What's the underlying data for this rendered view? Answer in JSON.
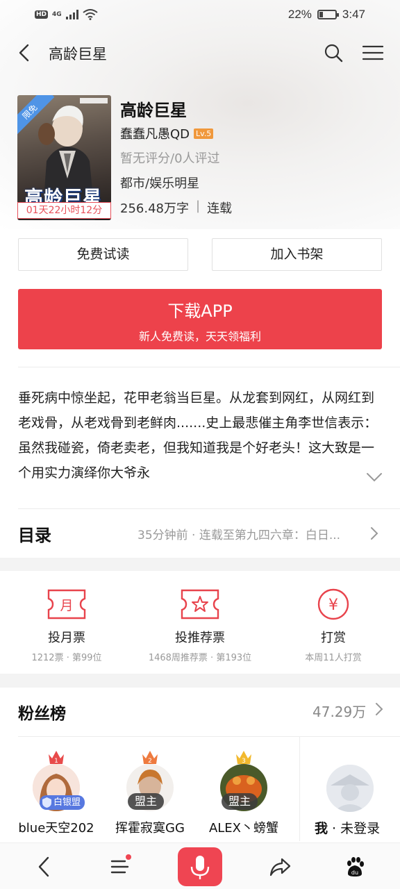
{
  "status_bar": {
    "hd": "HD",
    "network": "4G",
    "battery_text": "22%",
    "battery_level": 0.22,
    "time": "3:47"
  },
  "nav": {
    "title": "高龄巨星",
    "icons": [
      "back-icon",
      "search-icon",
      "menu-icon"
    ]
  },
  "book": {
    "cover_ribbon": "限免",
    "cover_title": "高龄巨星",
    "free_timer": "01天22小时12分",
    "title": "高龄巨星",
    "author": "蠢蠢凡愚QD",
    "author_level": "Lv.5",
    "rating": "暂无评分/0人评过",
    "genre": "都市/娱乐明星",
    "word_count": "256.48万字",
    "status": "连载"
  },
  "actions": {
    "try_read": "免费试读",
    "add_shelf": "加入书架"
  },
  "download": {
    "title": "下载APP",
    "subtitle": "新人免费读，天天领福利"
  },
  "intro": {
    "text": "垂死病中惊坐起，花甲老翁当巨星。从龙套到网红，从网红到老戏骨，从老戏骨到老鲜肉.......史上最悲催主角李世信表示：虽然我碰瓷，倚老卖老，但我知道我是个好老头！这大致是一个用实力演绎你大爷永"
  },
  "toc": {
    "label": "目录",
    "info": "35分钟前 · 连载至第九四六章：白日..."
  },
  "tickets": [
    {
      "name": "投月票",
      "sub": "1212票 · 第99位",
      "icon": "monthly-ticket-icon",
      "glyph": "月"
    },
    {
      "name": "投推荐票",
      "sub": "1468周推荐票 · 第193位",
      "icon": "recommend-ticket-icon"
    },
    {
      "name": "打赏",
      "sub": "本周11人打赏",
      "icon": "tip-yen-icon",
      "glyph": "¥"
    }
  ],
  "fans": {
    "title": "粉丝榜",
    "total": "47.29万",
    "list": [
      {
        "rank": "1",
        "badge": "白银盟",
        "name": "blue天空202"
      },
      {
        "rank": "2",
        "badge": "盟主",
        "name": "挥霍寂寞GG"
      },
      {
        "rank": "3",
        "badge": "盟主",
        "name": "ALEX丶螃蟹"
      }
    ],
    "me_prefix": "我",
    "me_status": " · 未登录"
  },
  "bottom_bar": {
    "icons": [
      "back-icon",
      "menu-icon",
      "microphone-icon",
      "share-icon",
      "baidu-logo-icon"
    ]
  },
  "colors": {
    "accent_red": "#ed424b",
    "ribbon_blue": "#4f94e6",
    "level_orange": "#f0983c",
    "silver_badge": "#5778e0"
  }
}
